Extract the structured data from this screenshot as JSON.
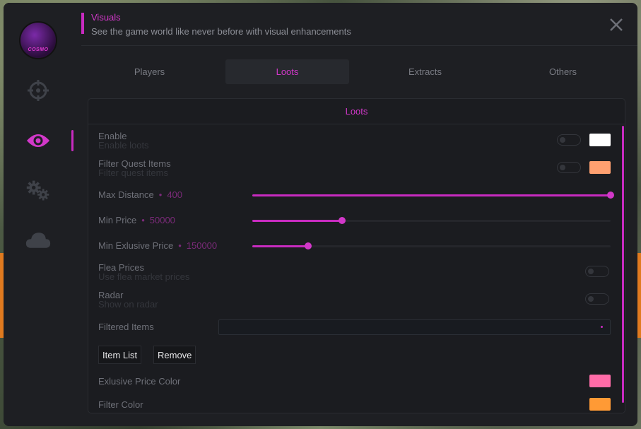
{
  "header": {
    "title": "Visuals",
    "subtitle": "See the game world like never before with visual enhancements"
  },
  "logo": {
    "text": "COSMO"
  },
  "sidebar": {
    "items": [
      {
        "icon": "crosshair-icon",
        "active": false
      },
      {
        "icon": "eye-icon",
        "active": true
      },
      {
        "icon": "gears-icon",
        "active": false
      },
      {
        "icon": "cloud-icon",
        "active": false
      }
    ]
  },
  "tabs": [
    {
      "label": "Players",
      "active": false
    },
    {
      "label": "Loots",
      "active": true
    },
    {
      "label": "Extracts",
      "active": false
    },
    {
      "label": "Others",
      "active": false
    }
  ],
  "panel": {
    "title": "Loots",
    "enable": {
      "label": "Enable",
      "desc": "Enable loots",
      "color": "#ffffff"
    },
    "filter_quest": {
      "label": "Filter Quest Items",
      "desc": "Filter quest items",
      "color": "#ffa070"
    },
    "max_distance": {
      "label": "Max Distance",
      "value": "400",
      "fraction": 1.0
    },
    "min_price": {
      "label": "Min Price",
      "value": "50000",
      "fraction": 0.25
    },
    "min_exclusive_price": {
      "label": "Min Exlusive Price",
      "value": "150000",
      "fraction": 0.155
    },
    "flea_prices": {
      "label": "Flea Prices",
      "desc": "Use flea market prices"
    },
    "radar": {
      "label": "Radar",
      "desc": "Show on radar"
    },
    "filtered_items": {
      "label": "Filtered Items",
      "value": ""
    },
    "item_list_button": "Item List",
    "remove_button": "Remove",
    "exclusive_color": {
      "label": "Exlusive Price Color",
      "color": "#ff6ca8"
    },
    "filter_color": {
      "label": "Filter Color",
      "color": "#ff9a35"
    }
  },
  "colors": {
    "accent": "#c82bc0",
    "background": "#1e1f23"
  }
}
